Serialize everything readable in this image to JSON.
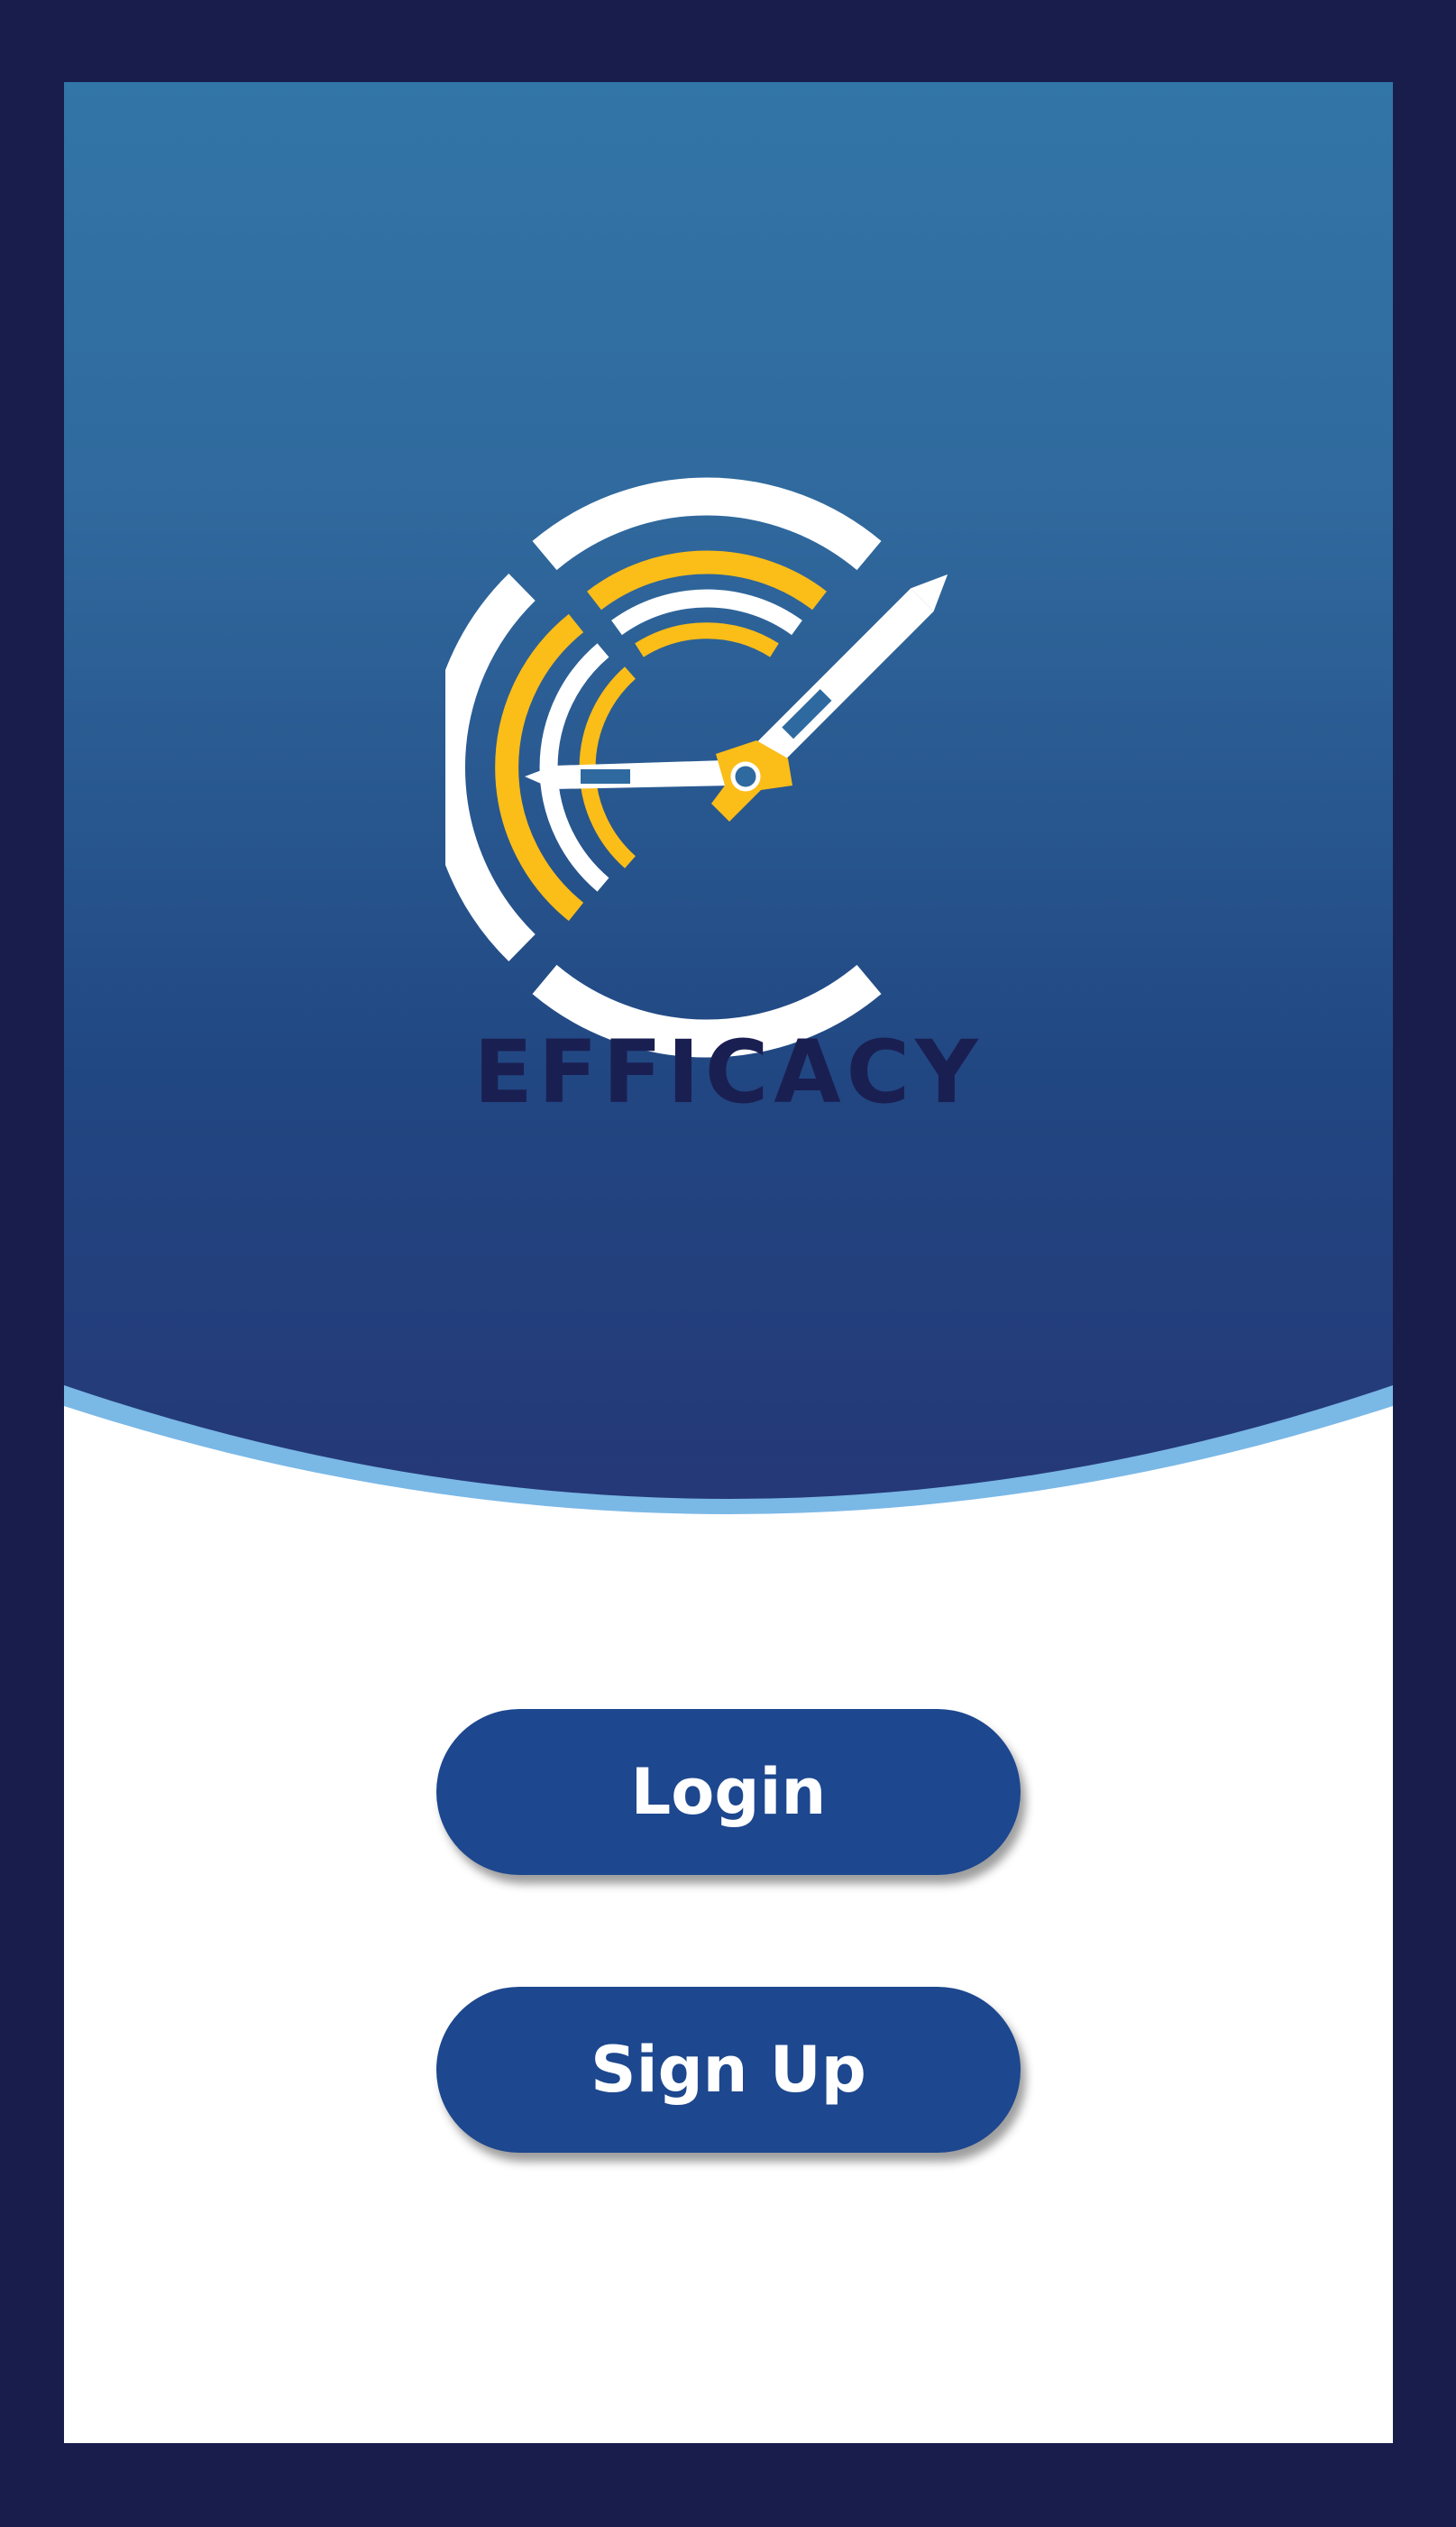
{
  "app": {
    "brand_name": "EFFICACY"
  },
  "actions": {
    "login_label": "Login",
    "signup_label": "Sign Up"
  },
  "colors": {
    "outer_frame": "#181d4c",
    "header_top": "#3275a7",
    "header_bottom": "#253877",
    "wave_accent": "#7ab8e6",
    "logo_white": "#ffffff",
    "logo_yellow": "#fbbd18",
    "brand_text": "#1a1f52",
    "button_bg": "#1d478e",
    "button_text": "#ffffff"
  },
  "icons": {
    "logo": "clock-c-pen-logo-icon"
  }
}
